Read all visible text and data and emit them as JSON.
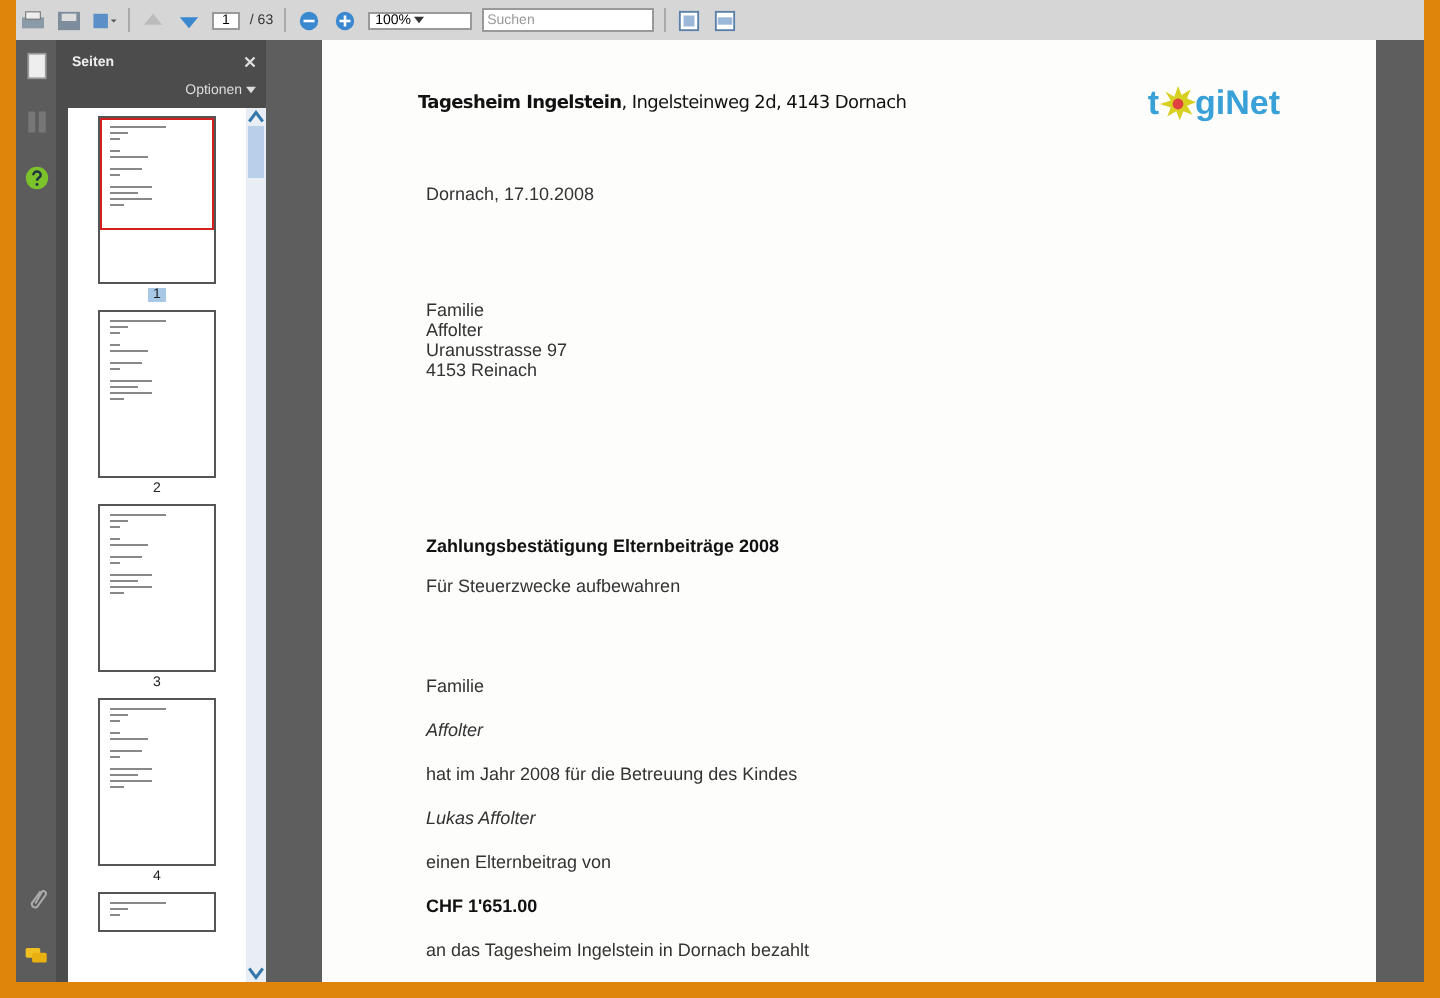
{
  "toolbar": {
    "page_number": "1",
    "page_total": "/ 63",
    "zoom": "100%",
    "search": {
      "placeholder": "Suchen"
    }
  },
  "sidebar": {
    "title": "Seiten",
    "options": "Optionen",
    "thumbnails": [
      {
        "label": "1",
        "selected": true
      },
      {
        "label": "2",
        "selected": false
      },
      {
        "label": "3",
        "selected": false
      },
      {
        "label": "4",
        "selected": false
      }
    ]
  },
  "document": {
    "letterhead": "**Tagesheim Ingelstein**, Ingelsteinweg 2d, 4143 Dornach",
    "logo": {
      "before": "t",
      "after": "giNet"
    },
    "date": "Dornach, 17.10.2008",
    "address": [
      "Familie",
      "Affolter",
      "Uranusstrasse 97",
      "4153 Reinach"
    ],
    "paragraphs": [
      {
        "kind": "heading",
        "text": "Zahlungsbestätigung Elternbeiträge 2008"
      },
      {
        "kind": "text",
        "text": "Für Steuerzwecke aufbewahren"
      },
      {
        "kind": "text",
        "text": "Familie"
      },
      {
        "kind": "italic",
        "text": "Affolter"
      },
      {
        "kind": "text",
        "text": "hat im Jahr 2008 für die Betreuung des Kindes"
      },
      {
        "kind": "italic",
        "text": "Lukas Affolter"
      },
      {
        "kind": "text",
        "text": "einen Elternbeitrag von"
      },
      {
        "kind": "amount",
        "text": "CHF 1'651.00"
      },
      {
        "kind": "text",
        "text": "an das Tagesheim Ingelstein in Dornach bezahlt"
      }
    ]
  }
}
